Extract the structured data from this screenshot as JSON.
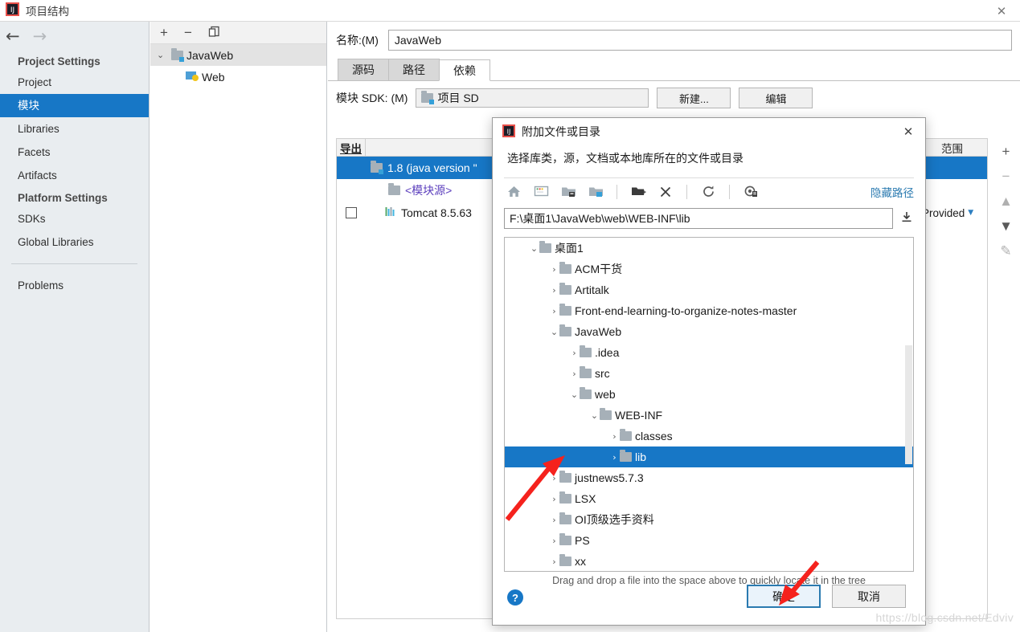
{
  "window": {
    "title": "项目结构",
    "close_label": "✕",
    "app_icon": "intellij-idea-icon"
  },
  "sidebar": {
    "nav": {
      "back": "←",
      "forward": "→"
    },
    "groups": [
      {
        "title": "Project Settings",
        "items": [
          {
            "label": "Project",
            "selected": false
          },
          {
            "label": "模块",
            "selected": true
          },
          {
            "label": "Libraries",
            "selected": false
          },
          {
            "label": "Facets",
            "selected": false
          },
          {
            "label": "Artifacts",
            "selected": false
          }
        ]
      },
      {
        "title": "Platform Settings",
        "items": [
          {
            "label": "SDKs",
            "selected": false
          },
          {
            "label": "Global Libraries",
            "selected": false
          }
        ]
      }
    ],
    "problems_label": "Problems"
  },
  "module_panel": {
    "toolbar": {
      "add": "+",
      "remove": "−",
      "copy": "copy-icon"
    },
    "tree": [
      {
        "label": "JavaWeb",
        "caret": "⌄",
        "selected": true,
        "indent": 0
      },
      {
        "label": "Web",
        "caret": "",
        "selected": false,
        "indent": 1
      }
    ]
  },
  "main": {
    "name_label": "名称:(M)",
    "name_value": "JavaWeb",
    "tabs": [
      {
        "label": "源码",
        "active": false
      },
      {
        "label": "路径",
        "active": false
      },
      {
        "label": "依赖",
        "active": true
      }
    ],
    "sdk_label": "模块 SDK: (M)",
    "sdk_value": "项目 SD",
    "sdk_buttons": [
      "新建...",
      "编辑"
    ],
    "dep_table": {
      "headers": {
        "export": "导出",
        "scope": "范围"
      },
      "rows": [
        {
          "name": "1.8 (java version \"",
          "scope": "",
          "checkbox": false,
          "selected": true,
          "icon": "sdk-folder-icon",
          "style": "normal"
        },
        {
          "name": "<模块源>",
          "scope": "",
          "checkbox": false,
          "selected": false,
          "icon": "module-source-icon",
          "style": "module-source"
        },
        {
          "name": "Tomcat 8.5.63",
          "scope": "Provided",
          "checkbox": true,
          "selected": false,
          "icon": "library-icon",
          "style": "normal"
        }
      ]
    },
    "side_toolbar": [
      "+",
      "−",
      "▲",
      "▼",
      "✎"
    ]
  },
  "dialog": {
    "title": "附加文件或目录",
    "close_label": "✕",
    "subtitle": "选择库类，源，文档或本地库所在的文件或目录",
    "toolbar_icons": [
      "home-icon",
      "desktop-icon",
      "drive-folder-icon",
      "module-folder-icon",
      "new-folder-icon",
      "delete-icon",
      "refresh-icon",
      "show-hidden-icon"
    ],
    "hide_path_label": "隐藏路径",
    "path_value": "F:\\桌面1\\JavaWeb\\web\\WEB-INF\\lib",
    "path_collapse_icon": "collapse-icon",
    "tree": [
      {
        "label": "桌面1",
        "indent": 0,
        "caret": "⌄",
        "selected": false
      },
      {
        "label": "ACM干货",
        "indent": 1,
        "caret": "›",
        "selected": false
      },
      {
        "label": "Artitalk",
        "indent": 1,
        "caret": "›",
        "selected": false
      },
      {
        "label": "Front-end-learning-to-organize-notes-master",
        "indent": 1,
        "caret": "›",
        "selected": false
      },
      {
        "label": "JavaWeb",
        "indent": 1,
        "caret": "⌄",
        "selected": false
      },
      {
        "label": ".idea",
        "indent": 2,
        "caret": "›",
        "selected": false
      },
      {
        "label": "src",
        "indent": 2,
        "caret": "›",
        "selected": false
      },
      {
        "label": "web",
        "indent": 2,
        "caret": "⌄",
        "selected": false
      },
      {
        "label": "WEB-INF",
        "indent": 3,
        "caret": "⌄",
        "selected": false
      },
      {
        "label": "classes",
        "indent": 4,
        "caret": "›",
        "selected": false
      },
      {
        "label": "lib",
        "indent": 4,
        "caret": "›",
        "selected": true
      },
      {
        "label": "justnews5.7.3",
        "indent": 1,
        "caret": "›",
        "selected": false
      },
      {
        "label": "LSX",
        "indent": 1,
        "caret": "›",
        "selected": false
      },
      {
        "label": "OI顶级选手资料",
        "indent": 1,
        "caret": "›",
        "selected": false
      },
      {
        "label": "PS",
        "indent": 1,
        "caret": "›",
        "selected": false
      },
      {
        "label": "xx",
        "indent": 1,
        "caret": "›",
        "selected": false
      }
    ],
    "drag_hint": "Drag and drop a file into the space above to quickly locate it in the tree",
    "help_label": "?",
    "ok_label": "确定",
    "cancel_label": "取消"
  },
  "watermark": "https://blog.csdn.net/Edviv",
  "colors": {
    "selection_blue": "#1777c6",
    "annotation_red": "#f5221d",
    "link_blue": "#2a7ab0"
  }
}
